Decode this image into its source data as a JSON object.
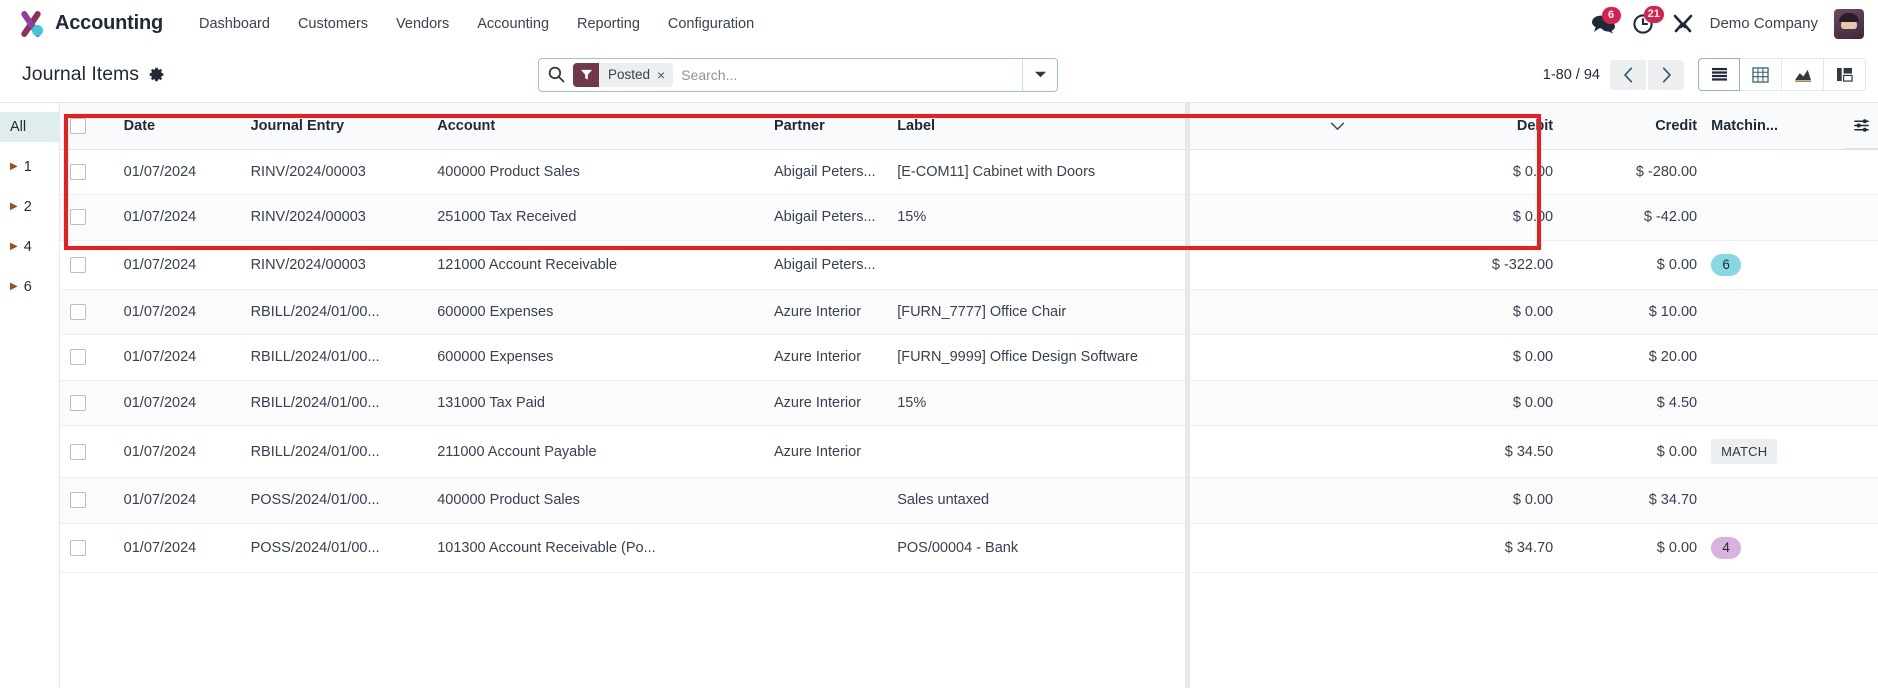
{
  "navbar": {
    "brand": "Accounting",
    "menu": [
      {
        "label": "Dashboard"
      },
      {
        "label": "Customers"
      },
      {
        "label": "Vendors"
      },
      {
        "label": "Accounting"
      },
      {
        "label": "Reporting"
      },
      {
        "label": "Configuration"
      }
    ],
    "messages_count": "6",
    "activities_count": "21",
    "company": "Demo Company"
  },
  "control_panel": {
    "title": "Journal Items",
    "search": {
      "facet_label": "Posted",
      "facet_remove": "×",
      "placeholder": "Search..."
    },
    "pager": {
      "value": "1-80 / 94",
      "prev": "‹",
      "next": "›"
    },
    "views": [
      {
        "name": "list-view",
        "label": "List"
      },
      {
        "name": "pivot-view",
        "label": "Pivot"
      },
      {
        "name": "graph-view",
        "label": "Graph"
      },
      {
        "name": "kanban-view",
        "label": "Kanban"
      }
    ]
  },
  "sidebar": {
    "items": [
      {
        "label": "All",
        "active": true,
        "caret": false
      },
      {
        "label": "1",
        "active": false,
        "caret": true
      },
      {
        "label": "2",
        "active": false,
        "caret": true
      },
      {
        "label": "4",
        "active": false,
        "caret": true
      },
      {
        "label": "6",
        "active": false,
        "caret": true
      }
    ]
  },
  "table": {
    "columns": [
      {
        "label": "Date",
        "align": "left"
      },
      {
        "label": "Journal Entry",
        "align": "left"
      },
      {
        "label": "Account",
        "align": "left"
      },
      {
        "label": "Partner",
        "align": "left"
      },
      {
        "label": "Label",
        "align": "left"
      },
      {
        "label": "Debit",
        "align": "right"
      },
      {
        "label": "Credit",
        "align": "right"
      },
      {
        "label": "Matchin...",
        "align": "left"
      }
    ],
    "rows": [
      {
        "date": "01/07/2024",
        "journal_entry": "RINV/2024/00003",
        "account": "400000 Product Sales",
        "partner": "Abigail Peters...",
        "label": "[E-COM11] Cabinet with Doors",
        "debit": "$ 0.00",
        "credit": "$ -280.00",
        "matching": "",
        "matching_type": "none"
      },
      {
        "date": "01/07/2024",
        "journal_entry": "RINV/2024/00003",
        "account": "251000 Tax Received",
        "partner": "Abigail Peters...",
        "label": "15%",
        "debit": "$ 0.00",
        "credit": "$ -42.00",
        "matching": "",
        "matching_type": "none"
      },
      {
        "date": "01/07/2024",
        "journal_entry": "RINV/2024/00003",
        "account": "121000 Account Receivable",
        "partner": "Abigail Peters...",
        "label": "",
        "debit": "$ -322.00",
        "credit": "$ 0.00",
        "matching": "6",
        "matching_type": "cyan"
      },
      {
        "date": "01/07/2024",
        "journal_entry": "RBILL/2024/01/00...",
        "account": "600000 Expenses",
        "partner": "Azure Interior",
        "label": "[FURN_7777] Office Chair",
        "debit": "$ 0.00",
        "credit": "$ 10.00",
        "matching": "",
        "matching_type": "none"
      },
      {
        "date": "01/07/2024",
        "journal_entry": "RBILL/2024/01/00...",
        "account": "600000 Expenses",
        "partner": "Azure Interior",
        "label": "[FURN_9999] Office Design Software",
        "debit": "$ 0.00",
        "credit": "$ 20.00",
        "matching": "",
        "matching_type": "none"
      },
      {
        "date": "01/07/2024",
        "journal_entry": "RBILL/2024/01/00...",
        "account": "131000 Tax Paid",
        "partner": "Azure Interior",
        "label": "15%",
        "debit": "$ 0.00",
        "credit": "$ 4.50",
        "matching": "",
        "matching_type": "none"
      },
      {
        "date": "01/07/2024",
        "journal_entry": "RBILL/2024/01/00...",
        "account": "211000 Account Payable",
        "partner": "Azure Interior",
        "label": "",
        "debit": "$ 34.50",
        "credit": "$ 0.00",
        "matching": "MATCH",
        "matching_type": "button"
      },
      {
        "date": "01/07/2024",
        "journal_entry": "POSS/2024/01/00...",
        "account": "400000 Product Sales",
        "partner": "",
        "label": "Sales untaxed",
        "debit": "$ 0.00",
        "credit": "$ 34.70",
        "matching": "",
        "matching_type": "none"
      },
      {
        "date": "01/07/2024",
        "journal_entry": "POSS/2024/01/00...",
        "account": "101300 Account Receivable (Po...",
        "partner": "",
        "label": "POS/00004 - Bank",
        "debit": "$ 34.70",
        "credit": "$ 0.00",
        "matching": "4",
        "matching_type": "purple"
      }
    ]
  },
  "colors": {
    "brand_purple": "#8f3fa0",
    "brand_teal": "#3ec9d6",
    "badge_red": "#d9214f",
    "link_teal": "#2a8a8e",
    "match_cyan": "#86d9e3",
    "match_purple": "#d9b3e0",
    "annotation_red": "#ee1c1c"
  }
}
